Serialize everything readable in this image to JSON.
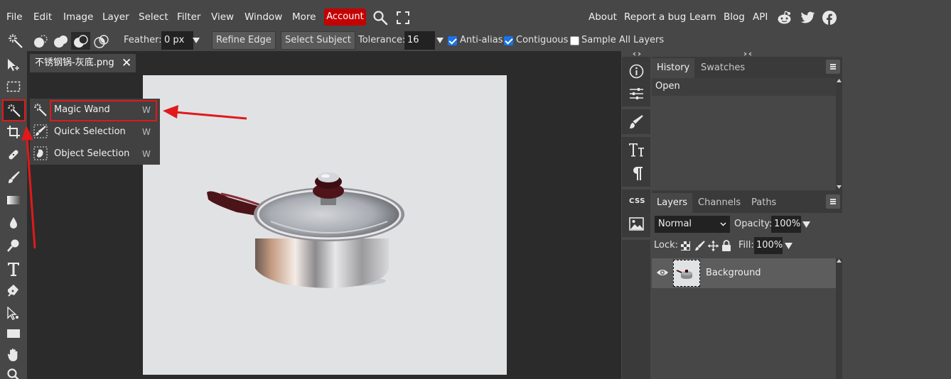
{
  "menubar": {
    "items": [
      "File",
      "Edit",
      "Image",
      "Layer",
      "Select",
      "Filter",
      "View",
      "Window",
      "More"
    ],
    "account": "Account",
    "right_links": [
      "About",
      "Report a bug",
      "Learn",
      "Blog",
      "API"
    ],
    "icons": [
      "search-icon",
      "fullscreen-icon",
      "reddit-icon",
      "twitter-icon",
      "facebook-icon"
    ]
  },
  "options": {
    "feather_label": "Feather:",
    "feather_value": "0 px",
    "refine_edge": "Refine Edge",
    "select_subject": "Select Subject",
    "tolerance_label": "Tolerance:",
    "tolerance_value": "16",
    "anti_alias": "Anti-alias",
    "contiguous": "Contiguous",
    "sample_all_layers": "Sample All Layers",
    "anti_alias_checked": true,
    "contiguous_checked": true,
    "sample_all_checked": false
  },
  "document": {
    "tab_title": "不锈钢锅-灰底.png",
    "close": "✕"
  },
  "flyout": {
    "items": [
      {
        "label": "Magic Wand",
        "key": "W"
      },
      {
        "label": "Quick Selection",
        "key": "W"
      },
      {
        "label": "Object Selection",
        "key": "W"
      }
    ]
  },
  "history_panel": {
    "tabs": [
      "History",
      "Swatches"
    ],
    "entries": [
      "Open"
    ]
  },
  "layers_panel": {
    "tabs": [
      "Layers",
      "Channels",
      "Paths"
    ],
    "blend_mode": "Normal",
    "opacity_label": "Opacity:",
    "opacity_value": "100%",
    "lock_label": "Lock:",
    "fill_label": "Fill:",
    "fill_value": "100%",
    "layers": [
      "Background"
    ]
  },
  "colors": {
    "accent_red": "#c50000",
    "annotation_red": "#e0191c",
    "checkbox_blue": "#1a73e8"
  }
}
